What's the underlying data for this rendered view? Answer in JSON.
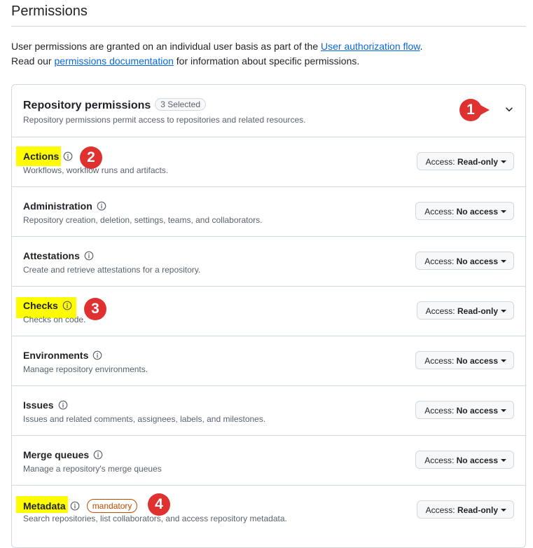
{
  "page": {
    "title": "Permissions",
    "intro_line1_prefix": "User permissions are granted on an individual user basis as part of the ",
    "intro_line1_link": "User authorization flow",
    "intro_line1_suffix": ".",
    "intro_line2_prefix": "Read our ",
    "intro_line2_link": "permissions documentation",
    "intro_line2_suffix": " for information about specific permissions."
  },
  "repository_permissions": {
    "title": "Repository permissions",
    "selected_badge": "3 Selected",
    "description": "Repository permissions permit access to repositories and related resources.",
    "items": [
      {
        "name": "Actions",
        "description": "Workflows, workflow runs and artifacts.",
        "access_prefix": "Access: ",
        "access_value": "Read-only"
      },
      {
        "name": "Administration",
        "description": "Repository creation, deletion, settings, teams, and collaborators.",
        "access_prefix": "Access: ",
        "access_value": "No access"
      },
      {
        "name": "Attestations",
        "description": "Create and retrieve attestations for a repository.",
        "access_prefix": "Access: ",
        "access_value": "No access"
      },
      {
        "name": "Checks",
        "description": "Checks on code.",
        "access_prefix": "Access: ",
        "access_value": "Read-only"
      },
      {
        "name": "Environments",
        "description": "Manage repository environments.",
        "access_prefix": "Access: ",
        "access_value": "No access"
      },
      {
        "name": "Issues",
        "description": "Issues and related comments, assignees, labels, and milestones.",
        "access_prefix": "Access: ",
        "access_value": "No access"
      },
      {
        "name": "Merge queues",
        "description": "Manage a repository's merge queues",
        "access_prefix": "Access: ",
        "access_value": "No access"
      },
      {
        "name": "Metadata",
        "description": "Search repositories, list collaborators, and access repository metadata.",
        "badge": "mandatory",
        "access_prefix": "Access: ",
        "access_value": "Read-only"
      }
    ]
  },
  "annotations": {
    "marker_1": "1",
    "marker_2": "2",
    "marker_3": "3",
    "marker_4": "4",
    "highlight_color": "#fffc00",
    "marker_color": "#e03131"
  },
  "colors": {
    "link": "#0969da",
    "border": "#d1d9e0",
    "muted_text": "#59636e",
    "mandatory_badge": "#bc4c00"
  },
  "icons": {
    "info": "info-icon",
    "chevron": "chevron-down-icon",
    "caret": "triangle-down-icon"
  }
}
